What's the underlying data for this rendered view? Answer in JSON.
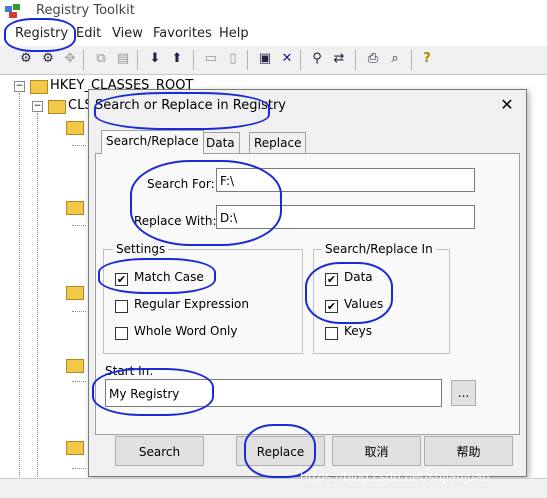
{
  "app": {
    "title": "Registry Toolkit",
    "icon": "registry-toolkit-icon"
  },
  "menu": {
    "items": [
      "Registry",
      "Edit",
      "View",
      "Favorites",
      "Help"
    ]
  },
  "tree": {
    "root_label": "HKEY_CLASSES_ROOT",
    "child_label": "CLS"
  },
  "dialog": {
    "title": "Search or Replace in Registry",
    "close_glyph": "✕",
    "tabs": [
      "Search/Replace",
      "Data",
      "Replace"
    ],
    "search_for_label": "Search For:",
    "search_for_value": "F:\\",
    "replace_with_label": "Replace With:",
    "replace_with_value": "D:\\",
    "settings": {
      "title": "Settings",
      "options": [
        {
          "label": "Match Case",
          "checked": true
        },
        {
          "label": "Regular Expression",
          "checked": false
        },
        {
          "label": "Whole Word Only",
          "checked": false
        }
      ]
    },
    "search_in": {
      "title": "Search/Replace In",
      "options": [
        {
          "label": "Data",
          "checked": true
        },
        {
          "label": "Values",
          "checked": true
        },
        {
          "label": "Keys",
          "checked": false
        }
      ]
    },
    "start_in_label": "Start In:",
    "start_in_value": "My Registry",
    "browse_label": "...",
    "buttons": {
      "search": "Search",
      "replace": "Replace",
      "cancel": "取消",
      "help": "帮助"
    }
  },
  "watermark": "https://blog.csdn.net/sujianjuan"
}
